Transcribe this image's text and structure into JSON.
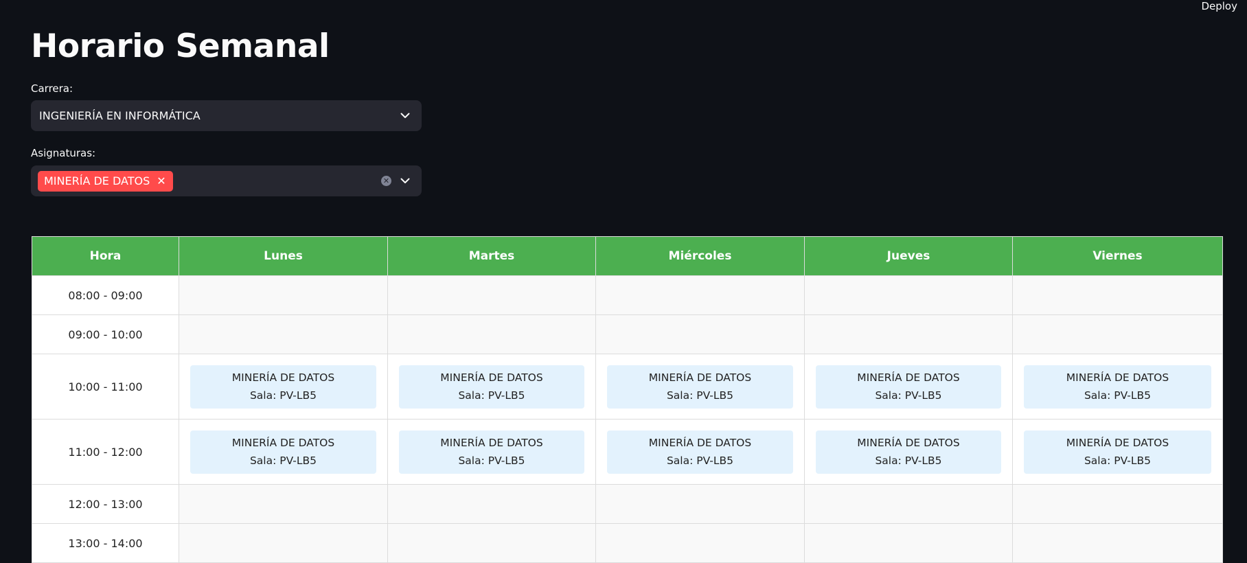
{
  "header": {
    "deploy_label": "Deploy"
  },
  "title": "Horario Semanal",
  "carrera": {
    "label": "Carrera:",
    "value": "INGENIERÍA EN INFORMÁTICA"
  },
  "asignaturas": {
    "label": "Asignaturas:",
    "selected": [
      "MINERÍA DE DATOS"
    ]
  },
  "table": {
    "headers": [
      "Hora",
      "Lunes",
      "Martes",
      "Miércoles",
      "Jueves",
      "Viernes"
    ],
    "rows": [
      {
        "hora": "08:00 - 09:00",
        "cells": [
          "",
          "",
          "",
          "",
          ""
        ]
      },
      {
        "hora": "09:00 - 10:00",
        "cells": [
          "",
          "",
          "",
          "",
          ""
        ]
      },
      {
        "hora": "10:00 - 11:00",
        "cells": [
          {
            "subject": "MINERÍA DE DATOS",
            "room": "Sala: PV-LB5"
          },
          {
            "subject": "MINERÍA DE DATOS",
            "room": "Sala: PV-LB5"
          },
          {
            "subject": "MINERÍA DE DATOS",
            "room": "Sala: PV-LB5"
          },
          {
            "subject": "MINERÍA DE DATOS",
            "room": "Sala: PV-LB5"
          },
          {
            "subject": "MINERÍA DE DATOS",
            "room": "Sala: PV-LB5"
          }
        ]
      },
      {
        "hora": "11:00 - 12:00",
        "cells": [
          {
            "subject": "MINERÍA DE DATOS",
            "room": "Sala: PV-LB5"
          },
          {
            "subject": "MINERÍA DE DATOS",
            "room": "Sala: PV-LB5"
          },
          {
            "subject": "MINERÍA DE DATOS",
            "room": "Sala: PV-LB5"
          },
          {
            "subject": "MINERÍA DE DATOS",
            "room": "Sala: PV-LB5"
          },
          {
            "subject": "MINERÍA DE DATOS",
            "room": "Sala: PV-LB5"
          }
        ]
      },
      {
        "hora": "12:00 - 13:00",
        "cells": [
          "",
          "",
          "",
          "",
          ""
        ]
      },
      {
        "hora": "13:00 - 14:00",
        "cells": [
          "",
          "",
          "",
          "",
          ""
        ]
      }
    ]
  },
  "colors": {
    "background": "#0e1117",
    "header_green": "#4caf50",
    "tag_red": "#ff4b4b",
    "card_blue": "#e3f2fd"
  }
}
